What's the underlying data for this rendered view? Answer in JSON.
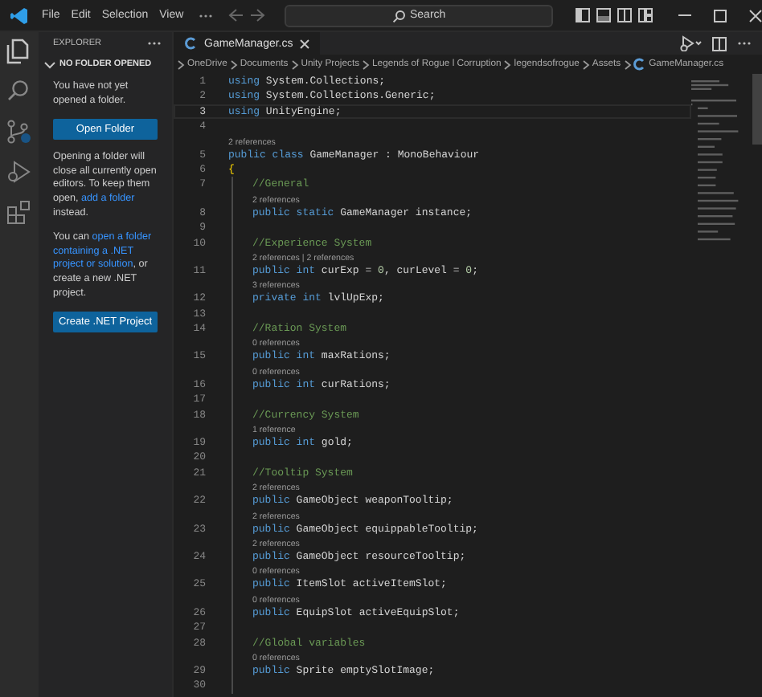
{
  "menu": [
    "File",
    "Edit",
    "Selection",
    "View"
  ],
  "search": {
    "placeholder": "Search"
  },
  "activity_bar": [
    {
      "kind": "files",
      "selected": true
    },
    {
      "kind": "search",
      "selected": false
    },
    {
      "kind": "source-control",
      "selected": false
    },
    {
      "kind": "run",
      "selected": false
    },
    {
      "kind": "extensions",
      "selected": false
    }
  ],
  "sidebar": {
    "title": "EXPLORER",
    "section": {
      "title": "NO FOLDER OPENED",
      "expanded": true
    },
    "content": [
      {
        "kind": "text",
        "parts": [
          {
            "text": "You have not yet opened a folder.",
            "link": false
          }
        ]
      },
      {
        "kind": "button",
        "label": "Open Folder"
      },
      {
        "kind": "text",
        "parts": [
          {
            "text": "Opening a folder will close all currently open editors. To keep them open, ",
            "link": false
          },
          {
            "text": "add a folder",
            "link": true
          },
          {
            "text": " instead.",
            "link": false
          }
        ]
      },
      {
        "kind": "text",
        "parts": [
          {
            "text": "You can",
            "link": false
          },
          {
            "text": "open a folder",
            "link": true
          },
          {
            "text": "containing a .NET",
            "link": true
          },
          {
            "text": "project or solution",
            "link": true
          },
          {
            "text": ", or create a new .NET project.",
            "link": false
          }
        ]
      },
      {
        "kind": "button",
        "label": "Create .NET Project"
      }
    ]
  },
  "tabs": [
    {
      "label": "GameManager.cs",
      "selected": true
    }
  ],
  "breadcrumbs": [
    "OneDrive",
    "Documents",
    "Unity Projects",
    "Legends of Rogue l Corruption",
    "legendsofrogue",
    "Assets"
  ],
  "breadcrumb_file": "GameManager.cs",
  "lines": [
    {
      "number": "1",
      "indented": false,
      "current": false,
      "tokens": [
        {
          "kind": "keyword",
          "text": "using"
        },
        {
          "kind": "plain",
          "text": " System.Collections;"
        }
      ]
    },
    {
      "number": "2",
      "indented": false,
      "current": false,
      "tokens": [
        {
          "kind": "keyword",
          "text": "using"
        },
        {
          "kind": "plain",
          "text": " System.Collections.Generic;"
        }
      ]
    },
    {
      "number": "3",
      "indented": false,
      "current": true,
      "tokens": [
        {
          "kind": "keyword",
          "text": "using"
        },
        {
          "kind": "plain",
          "text": " UnityEngine;"
        }
      ]
    },
    {
      "number": "4",
      "indented": false,
      "current": false
    },
    {
      "number": "5",
      "indented": false,
      "current": false,
      "lens": "2 references",
      "tokens": [
        {
          "kind": "keyword",
          "text": "public class"
        },
        {
          "kind": "plain",
          "text": " GameManager : MonoBehaviour"
        }
      ]
    },
    {
      "number": "6",
      "indented": false,
      "current": false,
      "tokens": [
        {
          "kind": "brace",
          "text": "{"
        }
      ]
    },
    {
      "number": "7",
      "indented": true,
      "current": false,
      "tokens": [
        {
          "kind": "comment",
          "text": "//General"
        }
      ]
    },
    {
      "number": "8",
      "indented": true,
      "current": false,
      "lens": "2 references",
      "tokens": [
        {
          "kind": "keyword",
          "text": "public static"
        },
        {
          "kind": "plain",
          "text": " GameManager instance;"
        }
      ]
    },
    {
      "number": "9",
      "indented": true,
      "current": false
    },
    {
      "number": "10",
      "indented": true,
      "current": false,
      "tokens": [
        {
          "kind": "comment",
          "text": "//Experience System"
        }
      ]
    },
    {
      "number": "11",
      "indented": true,
      "current": false,
      "lens": "2 references | 2 references",
      "tokens": [
        {
          "kind": "keyword",
          "text": "public int"
        },
        {
          "kind": "plain",
          "text": " curExp = "
        },
        {
          "kind": "number",
          "text": "0"
        },
        {
          "kind": "plain",
          "text": ", curLevel = "
        },
        {
          "kind": "number",
          "text": "0"
        },
        {
          "kind": "plain",
          "text": ";"
        }
      ]
    },
    {
      "number": "12",
      "indented": true,
      "current": false,
      "lens": "3 references",
      "tokens": [
        {
          "kind": "keyword",
          "text": "private int"
        },
        {
          "kind": "plain",
          "text": " lvlUpExp;"
        }
      ]
    },
    {
      "number": "13",
      "indented": true,
      "current": false
    },
    {
      "number": "14",
      "indented": true,
      "current": false,
      "tokens": [
        {
          "kind": "comment",
          "text": "//Ration System"
        }
      ]
    },
    {
      "number": "15",
      "indented": true,
      "current": false,
      "lens": "0 references",
      "tokens": [
        {
          "kind": "keyword",
          "text": "public int"
        },
        {
          "kind": "plain",
          "text": " maxRations;"
        }
      ]
    },
    {
      "number": "16",
      "indented": true,
      "current": false,
      "lens": "0 references",
      "tokens": [
        {
          "kind": "keyword",
          "text": "public int"
        },
        {
          "kind": "plain",
          "text": " curRations;"
        }
      ]
    },
    {
      "number": "17",
      "indented": true,
      "current": false
    },
    {
      "number": "18",
      "indented": true,
      "current": false,
      "tokens": [
        {
          "kind": "comment",
          "text": "//Currency System"
        }
      ]
    },
    {
      "number": "19",
      "indented": true,
      "current": false,
      "lens": "1 reference",
      "tokens": [
        {
          "kind": "keyword",
          "text": "public int"
        },
        {
          "kind": "plain",
          "text": " gold;"
        }
      ]
    },
    {
      "number": "20",
      "indented": true,
      "current": false
    },
    {
      "number": "21",
      "indented": true,
      "current": false,
      "tokens": [
        {
          "kind": "comment",
          "text": "//Tooltip System"
        }
      ]
    },
    {
      "number": "22",
      "indented": true,
      "current": false,
      "lens": "2 references",
      "tokens": [
        {
          "kind": "keyword",
          "text": "public"
        },
        {
          "kind": "plain",
          "text": " GameObject weaponTooltip;"
        }
      ]
    },
    {
      "number": "23",
      "indented": true,
      "current": false,
      "lens": "2 references",
      "tokens": [
        {
          "kind": "keyword",
          "text": "public"
        },
        {
          "kind": "plain",
          "text": " GameObject equippableTooltip;"
        }
      ]
    },
    {
      "number": "24",
      "indented": true,
      "current": false,
      "lens": "2 references",
      "tokens": [
        {
          "kind": "keyword",
          "text": "public"
        },
        {
          "kind": "plain",
          "text": " GameObject resourceTooltip;"
        }
      ]
    },
    {
      "number": "25",
      "indented": true,
      "current": false,
      "lens": "0 references",
      "tokens": [
        {
          "kind": "keyword",
          "text": "public"
        },
        {
          "kind": "plain",
          "text": " ItemSlot activeItemSlot;"
        }
      ]
    },
    {
      "number": "26",
      "indented": true,
      "current": false,
      "lens": "0 references",
      "tokens": [
        {
          "kind": "keyword",
          "text": "public"
        },
        {
          "kind": "plain",
          "text": " EquipSlot activeEquipSlot;"
        }
      ]
    },
    {
      "number": "27",
      "indented": true,
      "current": false
    },
    {
      "number": "28",
      "indented": true,
      "current": false,
      "tokens": [
        {
          "kind": "comment",
          "text": "//Global variables"
        }
      ]
    },
    {
      "number": "29",
      "indented": true,
      "current": false,
      "lens": "0 references",
      "tokens": [
        {
          "kind": "keyword",
          "text": "public"
        },
        {
          "kind": "plain",
          "text": " Sprite emptySlotImage;"
        }
      ]
    },
    {
      "number": "30",
      "indented": true,
      "current": false
    }
  ]
}
